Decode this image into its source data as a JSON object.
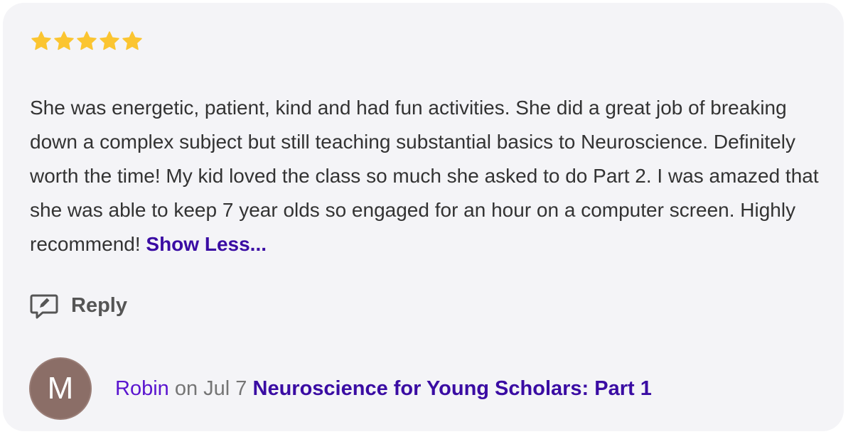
{
  "review": {
    "rating": 5,
    "rating_max": 5,
    "star_color": "#fbc531",
    "text": "She was energetic, patient, kind and had fun activities. She did a great job of breaking down a complex subject but still teaching substantial basics to Neuroscience. Definitely worth the time! My kid loved the class so much she asked to do Part 2. I was amazed that she was able to keep 7 year olds so engaged for an hour on a computer screen. Highly recommend!",
    "toggle_label": "Show Less..."
  },
  "actions": {
    "reply_icon": "comment-edit-icon",
    "reply_label": "Reply"
  },
  "author": {
    "avatar_initial": "M",
    "avatar_color": "#8b6e67",
    "name": "Robin",
    "date_prefix": "on",
    "date": "Jul 7",
    "course": "Neuroscience for Young Scholars: Part 1"
  }
}
